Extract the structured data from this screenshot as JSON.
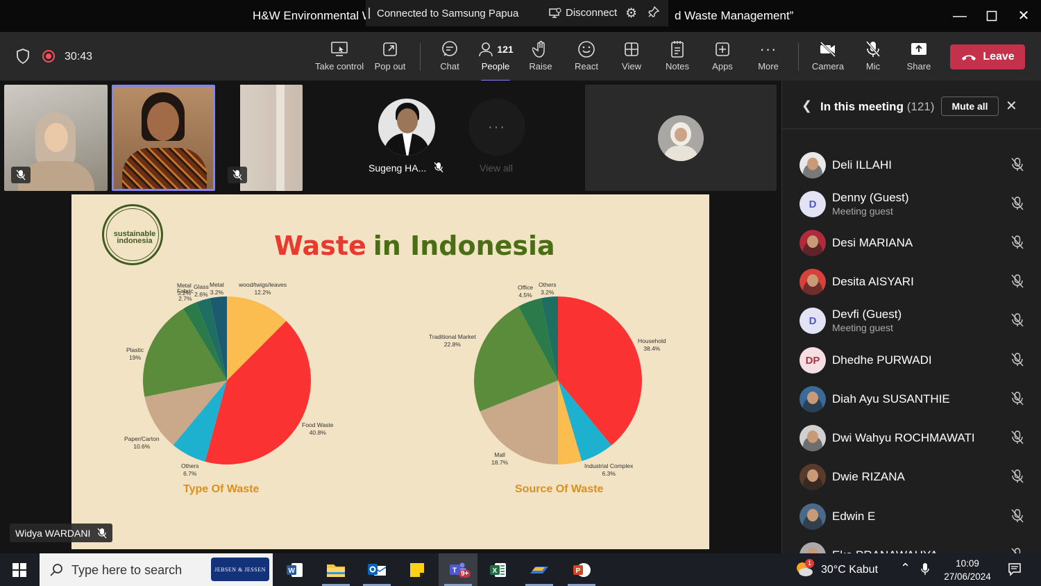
{
  "titlebar": {
    "title_left": "H&W Environmental W",
    "title_right": "d Waste Management”",
    "remote_banner": "Connected to Samsung Papua",
    "disconnect_label": "Disconnect"
  },
  "meeting": {
    "timer": "30:43",
    "toolbar": {
      "take_control": "Take control",
      "pop_out": "Pop out",
      "chat": "Chat",
      "people": "People",
      "people_count": "121",
      "raise": "Raise",
      "react": "React",
      "view": "View",
      "notes": "Notes",
      "apps": "Apps",
      "more": "More",
      "camera": "Camera",
      "mic": "Mic",
      "share": "Share",
      "leave": "Leave"
    },
    "tiles": {
      "sugeng_name": "Sugeng HA...",
      "view_all": "View all"
    },
    "presenter_name": "Widya WARDANI"
  },
  "slide": {
    "logo_line1": "sustainable",
    "logo_line2": "indonesia",
    "title_part1": "Waste",
    "title_part2": "in Indonesia",
    "pie1_caption": "Type Of Waste",
    "pie2_caption": "Source Of Waste"
  },
  "chart_data": [
    {
      "type": "pie",
      "title": "Type Of Waste",
      "categories": [
        "wood/twigs/leaves",
        "Food Waste",
        "Others",
        "Paper/Carton",
        "Plastic",
        "Fabric",
        "Glass",
        "Metal"
      ],
      "values": [
        12.2,
        40.8,
        6.7,
        10.6,
        19,
        2.7,
        2.6,
        3.2
      ],
      "value_labels": [
        "12.2%",
        "40.8%",
        "6.7%",
        "10.6%",
        "19%",
        "2.7%",
        "2.6%",
        "3.2%"
      ],
      "colors": [
        "#fbbd4f",
        "#fb3232",
        "#1db0cf",
        "#c9a98a",
        "#5b8c3c",
        "#2a7a4a",
        "#1f6e62",
        "#1c5a70"
      ]
    },
    {
      "type": "pie",
      "title": "Source Of Waste",
      "categories": [
        "Household",
        "Industrial Complex",
        "",
        "Mall",
        "Traditional Market",
        "Office",
        "Others"
      ],
      "values": [
        38.4,
        6.3,
        4.5,
        18.7,
        22.8,
        4.5,
        3.2
      ],
      "value_labels": [
        "38.4%",
        "6.3%",
        "",
        "18.7%",
        "22.8%",
        "4.5%",
        "3.2%"
      ],
      "colors": [
        "#fb3232",
        "#1db0cf",
        "#fbbd4f",
        "#c9a98a",
        "#5b8c3c",
        "#2a7a4a",
        "#1f6e62"
      ]
    }
  ],
  "panel": {
    "title": "In this meeting",
    "count": "(121)",
    "mute_all": "Mute all",
    "participants": [
      {
        "name": "Deli ILLAHI",
        "sub": "",
        "initials": "",
        "color": "#e8e8e8"
      },
      {
        "name": "Denny (Guest)",
        "sub": "Meeting guest",
        "initials": "D",
        "color": "#e3e3f5"
      },
      {
        "name": "Desi MARIANA",
        "sub": "",
        "initials": "",
        "color": "#b02a3a"
      },
      {
        "name": "Desita AISYARI",
        "sub": "",
        "initials": "",
        "color": "#d8403a"
      },
      {
        "name": "Devfi (Guest)",
        "sub": "Meeting guest",
        "initials": "D",
        "color": "#e3e3f5"
      },
      {
        "name": "Dhedhe PURWADI",
        "sub": "",
        "initials": "DP",
        "color": "#f6dfe3"
      },
      {
        "name": "Diah Ayu SUSANTHIE",
        "sub": "",
        "initials": "",
        "color": "#3a6a9a"
      },
      {
        "name": "Dwi Wahyu ROCHMAWATI",
        "sub": "",
        "initials": "",
        "color": "#d0d0d0"
      },
      {
        "name": "Dwie RIZANA",
        "sub": "",
        "initials": "",
        "color": "#5a3a2a"
      },
      {
        "name": "Edwin E",
        "sub": "",
        "initials": "",
        "color": "#4a6a8a"
      },
      {
        "name": "Eko PRANAWAHYA",
        "sub": "",
        "initials": "",
        "color": "#aaaaaa"
      }
    ]
  },
  "taskbar": {
    "search_placeholder": "Type here to search",
    "brand": "JEBSEN & JESSEN",
    "teams_badge": "9+",
    "weather": "30°C  Kabut",
    "weather_badge": "1",
    "time": "10:09",
    "date": "27/06/2024"
  }
}
